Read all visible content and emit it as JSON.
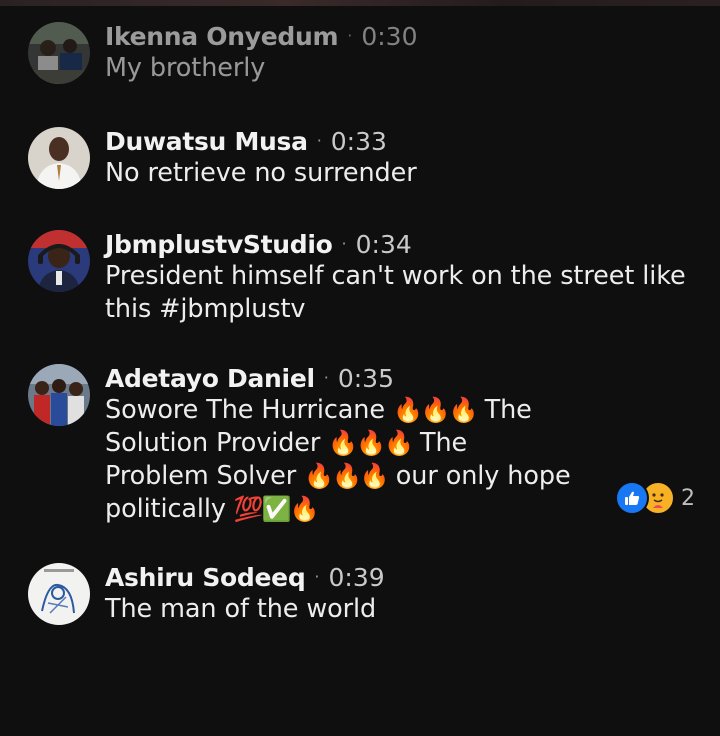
{
  "comments": [
    {
      "author": "Ikenna Onyedum",
      "time": "0:30",
      "text": "My brotherly",
      "avatar_icon": "avatar-photo-group"
    },
    {
      "author": "Duwatsu Musa",
      "time": "0:33",
      "text": "No retrieve no surrender",
      "avatar_icon": "avatar-photo-man-white-shirt"
    },
    {
      "author": "JbmplustvStudio",
      "time": "0:34",
      "text_line1": "President himself can't work on the street like",
      "text_line2": "this #jbmplustv",
      "avatar_icon": "avatar-photo-boy-headset"
    },
    {
      "author": "Adetayo Daniel",
      "time": "0:35",
      "line1_text": "Sowore The Hurricane",
      "line1_end": "The",
      "line2_text": "Solution Provider",
      "line2_end": "The",
      "line3_text": "Problem Solver",
      "line3_end": "our only hope",
      "line4_text": "politically",
      "emoji_fire": "🔥🔥🔥",
      "emoji_fire_single": "🔥",
      "emoji_hundred": "💯",
      "emoji_check": "✅",
      "reactions": {
        "types": [
          "like-icon",
          "care-icon"
        ],
        "count": "2"
      },
      "avatar_icon": "avatar-photo-crowd"
    },
    {
      "author": "Ashiru Sodeeq",
      "time": "0:39",
      "text": "The man of the world",
      "avatar_icon": "avatar-photo-sketch"
    }
  ],
  "separator": "·",
  "colors": {
    "background": "#0f0f10",
    "like_blue": "#1877f2",
    "text": "#ededed"
  }
}
